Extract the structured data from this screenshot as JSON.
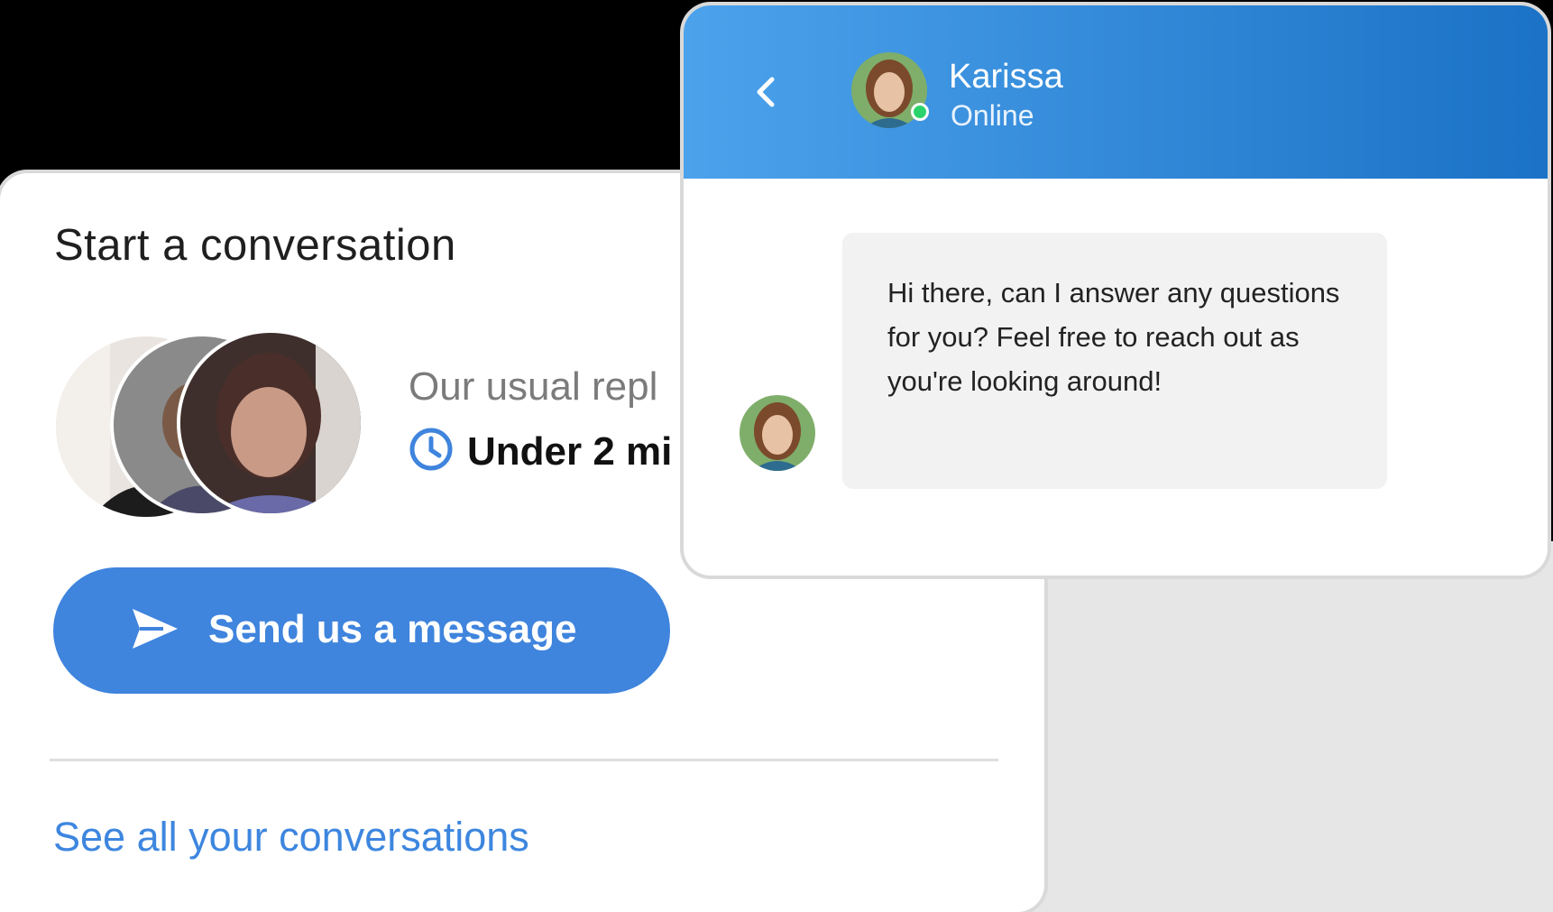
{
  "start_card": {
    "title": "Start a conversation",
    "reply_time_label": "Our usual repl",
    "reply_time_value": "Under 2 mi",
    "send_button_label": "Send us a message",
    "see_all_link": "See all your conversations"
  },
  "chat_window": {
    "agent_name": "Karissa",
    "agent_status": "Online",
    "message": "Hi there, can I answer any questions for you? Feel free to reach out as you're looking around!"
  },
  "colors": {
    "accent": "#3f84dd",
    "header_gradient_start": "#4ca2eb",
    "header_gradient_end": "#1b72c6",
    "link": "#3d86df",
    "online": "#2bd46a"
  },
  "icons": [
    "clock-icon",
    "send-icon",
    "chevron-left-icon"
  ]
}
